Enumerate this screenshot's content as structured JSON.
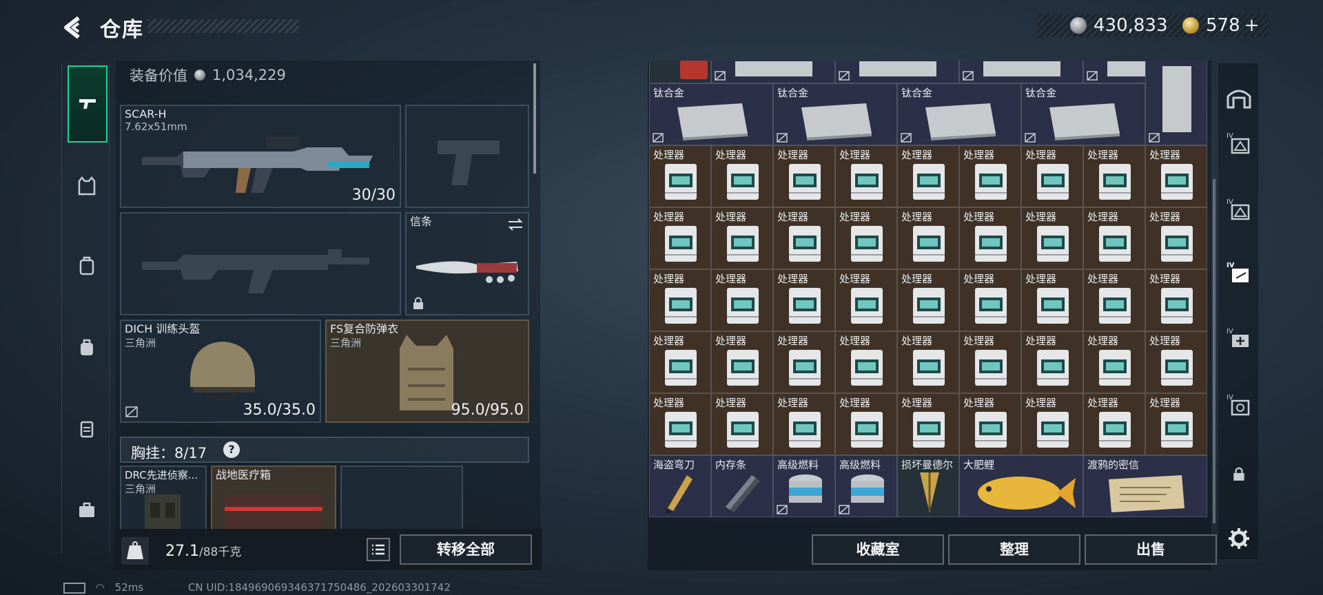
{
  "header": {
    "title": "仓库",
    "currency_main": "430,833",
    "currency_premium": "578",
    "premium_add": "+"
  },
  "loadout": {
    "equip_value_label": "装备价值",
    "equip_value": "1,034,229",
    "primary": {
      "name": "SCAR-H",
      "caliber": "7.62x51mm",
      "ammo": "30/30"
    },
    "melee": {
      "name": "信条",
      "swap_icon": "swap-arrows-icon",
      "lock_icon": "lock-icon"
    },
    "helmet": {
      "name": "DICH 训练头盔",
      "brand": "三角洲",
      "durability": "35.0/35.0"
    },
    "armor": {
      "name": "FS复合防弹衣",
      "brand": "三角洲",
      "durability": "95.0/95.0"
    },
    "chest_rig_label": "胸挂：8/17",
    "help": "?",
    "rig_items": [
      {
        "name": "DRC先进侦察...",
        "brand": "三角洲"
      },
      {
        "name": "战地医疗箱",
        "brand": ""
      }
    ],
    "weight_current": "27.1",
    "weight_max": "/88千克",
    "transfer_all": "转移全部"
  },
  "stash": {
    "titanium_label": "钛合金",
    "processor_label": "处理器",
    "bottom_items": [
      "海盗弯刀",
      "内存条",
      "高级燃料",
      "高级燃料",
      "损坏曼德尔",
      "大肥鲤",
      "渡鸦的密信"
    ],
    "collection_room": "收藏室",
    "sort": "整理",
    "sell": "出售"
  },
  "status": {
    "ping": "52ms",
    "uid": "CN UID:184969069346371750486_202603301742"
  },
  "colors": {
    "accent": "#17d49a",
    "cell_blue": "#2c2f48",
    "cell_brown": "#3f3126"
  }
}
